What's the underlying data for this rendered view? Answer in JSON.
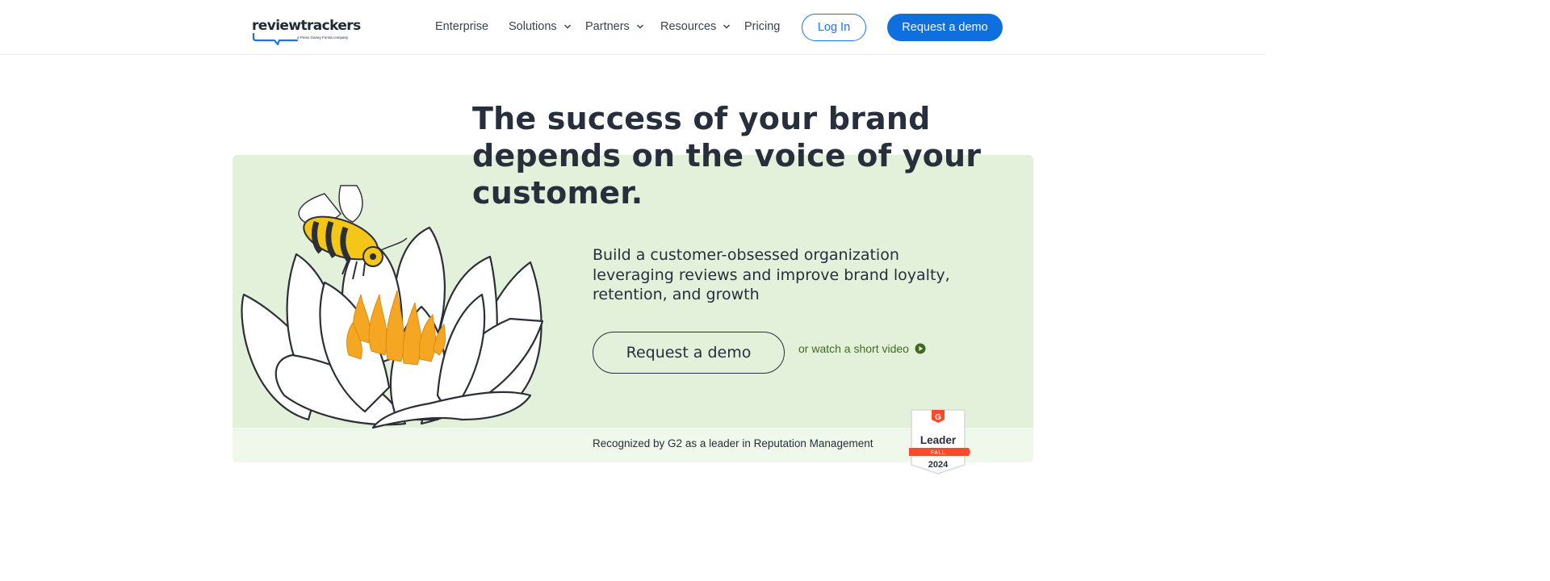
{
  "header": {
    "logo": {
      "text": "reviewtrackers",
      "sub": "a Press Ganey Forsta company"
    },
    "nav": [
      {
        "label": "Enterprise",
        "dropdown": false
      },
      {
        "label": "Solutions",
        "dropdown": true
      },
      {
        "label": "Partners",
        "dropdown": true
      },
      {
        "label": "Resources",
        "dropdown": true
      },
      {
        "label": "Pricing",
        "dropdown": false
      }
    ],
    "login_label": "Log In",
    "demo_label": "Request a demo"
  },
  "hero": {
    "headline": "The success of your brand depends on the voice of your customer.",
    "subhead": "Build a customer-obsessed organization leveraging reviews and improve brand loyalty, retention, and growth",
    "cta_label": "Request a demo",
    "video_label": "or watch a short video",
    "g2_text": "Recognized by G2 as a leader in Reputation Management"
  },
  "badge": {
    "brand": "G",
    "title": "Leader",
    "season": "FALL",
    "year": "2024"
  },
  "colors": {
    "primary": "#0f6fde",
    "hero_bg": "#e3f1da",
    "strip_bg": "#f0f8eb",
    "text_dark": "#262f3b",
    "link_green": "#3d6b1f",
    "g2_red": "#ff492c"
  }
}
